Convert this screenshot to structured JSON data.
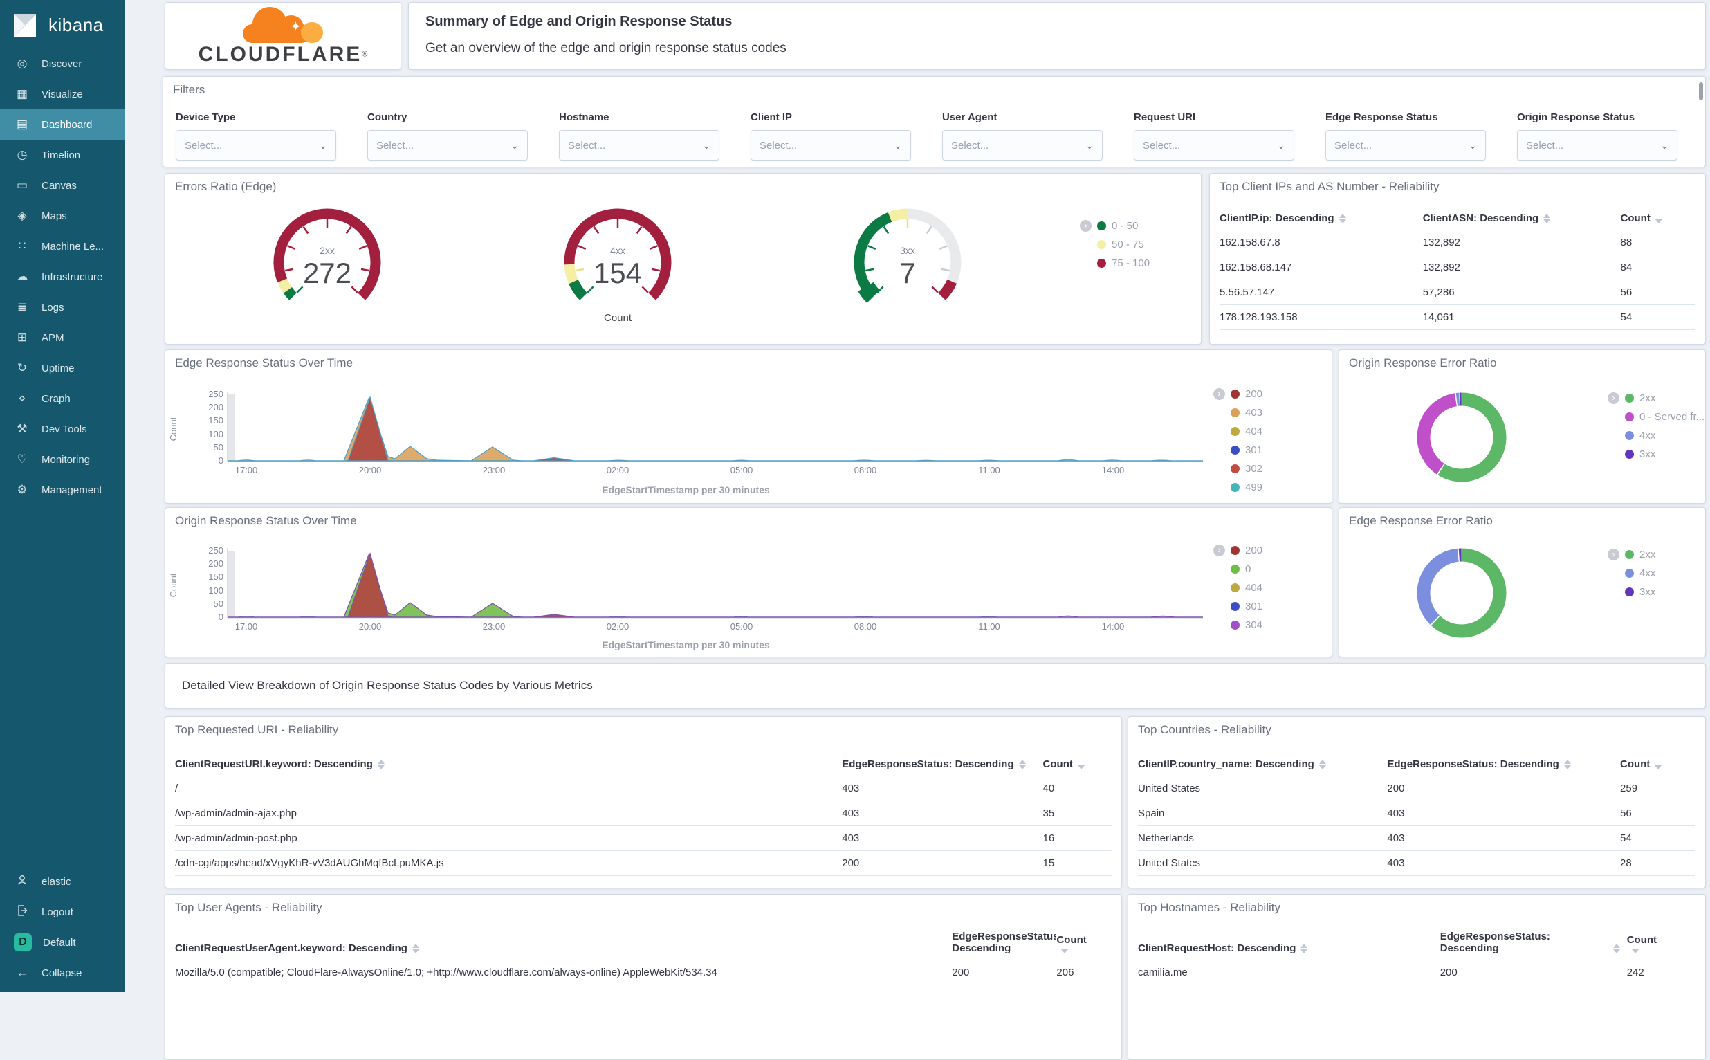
{
  "sidebar": {
    "logo_text": "kibana",
    "items": [
      {
        "label": "Discover",
        "icon": "compass"
      },
      {
        "label": "Visualize",
        "icon": "bar-chart"
      },
      {
        "label": "Dashboard",
        "icon": "dashboard-grid"
      },
      {
        "label": "Timelion",
        "icon": "time-chart"
      },
      {
        "label": "Canvas",
        "icon": "canvas"
      },
      {
        "label": "Maps",
        "icon": "map-marker"
      },
      {
        "label": "Machine Le...",
        "icon": "machine-learning"
      },
      {
        "label": "Infrastructure",
        "icon": "cloud"
      },
      {
        "label": "Logs",
        "icon": "logs"
      },
      {
        "label": "APM",
        "icon": "apm"
      },
      {
        "label": "Uptime",
        "icon": "uptime-clock"
      },
      {
        "label": "Graph",
        "icon": "graph-nodes"
      },
      {
        "label": "Dev Tools",
        "icon": "wrench"
      },
      {
        "label": "Monitoring",
        "icon": "heartbeat"
      },
      {
        "label": "Management",
        "icon": "gear"
      }
    ],
    "footer": [
      {
        "label": "elastic",
        "icon": "user"
      },
      {
        "label": "Logout",
        "icon": "exit"
      },
      {
        "label": "Default",
        "icon": "space-badge",
        "badge": "D"
      },
      {
        "label": "Collapse",
        "icon": "arrow-left"
      }
    ]
  },
  "header": {
    "brand": "CLOUDFLARE",
    "title": "Summary of Edge and Origin Response Status",
    "subtitle": "Get an overview of the edge and origin response status codes"
  },
  "filters": {
    "title": "Filters",
    "placeholder": "Select...",
    "fields": [
      "Device Type",
      "Country",
      "Hostname",
      "Client IP",
      "User Agent",
      "Request URI",
      "Edge Response Status",
      "Origin Response Status"
    ]
  },
  "markdown": {
    "text": "Detailed View Breakdown of Origin Response Status Codes by Various Metrics"
  },
  "chart_data": [
    {
      "id": "errors-ratio-edge",
      "type": "gauge",
      "title": "Errors Ratio (Edge)",
      "metric_label": "Count",
      "gauges": [
        {
          "label": "2xx",
          "value": 272
        },
        {
          "label": "4xx",
          "value": 154
        },
        {
          "label": "3xx",
          "value": 7
        }
      ],
      "ranges": [
        {
          "label": "0 - 50",
          "color": "#0B7A44"
        },
        {
          "label": "50 - 75",
          "color": "#F5EFA6"
        },
        {
          "label": "75 - 100",
          "color": "#A31F3E"
        }
      ]
    },
    {
      "id": "edge-response-status-over-time",
      "type": "area",
      "title": "Edge Response Status Over Time",
      "xlabel": "EdgeStartTimestamp per 30 minutes",
      "ylabel": "Count",
      "ylim": [
        0,
        250
      ],
      "y_ticks": [
        "0",
        "50",
        "100",
        "150",
        "200",
        "250"
      ],
      "x_ticks": [
        "17:00",
        "20:00",
        "23:00",
        "02:00",
        "05:00",
        "08:00",
        "11:00",
        "14:00"
      ],
      "legend_position": "right",
      "grid": false,
      "series": [
        {
          "name": "200",
          "color": "#A03533",
          "points": {
            "20:00": 240,
            "00:30": 12
          }
        },
        {
          "name": "403",
          "color": "#D9A15B",
          "points": {
            "20:00": 235,
            "21:00": 55,
            "23:00": 52
          }
        },
        {
          "name": "404",
          "color": "#BCA940",
          "points": {}
        },
        {
          "name": "301",
          "color": "#3C4EC6",
          "points": {}
        },
        {
          "name": "302",
          "color": "#C14C41",
          "points": {
            "21:30": 4
          }
        },
        {
          "name": "499",
          "color": "#45B5B8",
          "points": {
            "13:00": 3
          }
        }
      ]
    },
    {
      "id": "origin-response-error-ratio",
      "type": "pie",
      "title": "Origin Response Error Ratio",
      "slices": [
        {
          "label": "2xx",
          "value": 59.5,
          "color": "#5CB767"
        },
        {
          "label": "0 - Served fr...",
          "value": 38.5,
          "color": "#C050C9"
        },
        {
          "label": "4xx",
          "value": 1.2,
          "color": "#7B8FDE"
        },
        {
          "label": "3xx",
          "value": 0.8,
          "color": "#6135BE"
        }
      ]
    },
    {
      "id": "origin-response-status-over-time",
      "type": "area",
      "title": "Origin Response Status Over Time",
      "xlabel": "EdgeStartTimestamp per 30 minutes",
      "ylabel": "Count",
      "ylim": [
        0,
        250
      ],
      "y_ticks": [
        "0",
        "50",
        "100",
        "150",
        "200",
        "250"
      ],
      "x_ticks": [
        "17:00",
        "20:00",
        "23:00",
        "02:00",
        "05:00",
        "08:00",
        "11:00",
        "14:00"
      ],
      "legend_position": "right",
      "grid": false,
      "series": [
        {
          "name": "200",
          "color": "#A03533",
          "points": {
            "20:00": 240,
            "00:30": 10
          }
        },
        {
          "name": "0",
          "color": "#6CBF42",
          "points": {
            "20:00": 235,
            "21:00": 55,
            "23:00": 52
          }
        },
        {
          "name": "404",
          "color": "#BCA940",
          "points": {}
        },
        {
          "name": "301",
          "color": "#3C4EC6",
          "points": {}
        },
        {
          "name": "304",
          "color": "#A14FC9",
          "points": {
            "13:00": 3,
            "15:00": 3
          }
        }
      ]
    },
    {
      "id": "edge-response-error-ratio",
      "type": "pie",
      "title": "Edge Response Error Ratio",
      "slices": [
        {
          "label": "2xx",
          "value": 62.5,
          "color": "#5CB767"
        },
        {
          "label": "4xx",
          "value": 36.5,
          "color": "#7B8FDE"
        },
        {
          "label": "3xx",
          "value": 1,
          "color": "#6135BE"
        }
      ]
    }
  ],
  "tables": {
    "client_ips": {
      "title": "Top Client IPs and AS Number - Reliability",
      "columns": [
        "ClientIP.ip: Descending",
        "ClientASN: Descending",
        "Count"
      ],
      "rows": [
        [
          "162.158.67.8",
          "132,892",
          "88"
        ],
        [
          "162.158.68.147",
          "132,892",
          "84"
        ],
        [
          "5.56.57.147",
          "57,286",
          "56"
        ],
        [
          "178.128.193.158",
          "14,061",
          "54"
        ]
      ]
    },
    "requested_uri": {
      "title": "Top Requested URI - Reliability",
      "columns": [
        "ClientRequestURI.keyword: Descending",
        "EdgeResponseStatus: Descending",
        "Count"
      ],
      "rows": [
        [
          "/",
          "403",
          "40"
        ],
        [
          "/wp-admin/admin-ajax.php",
          "403",
          "35"
        ],
        [
          "/wp-admin/admin-post.php",
          "403",
          "16"
        ],
        [
          "/cdn-cgi/apps/head/xVgyKhR-vV3dAUGhMqfBcLpuMKA.js",
          "200",
          "15"
        ]
      ]
    },
    "countries": {
      "title": "Top Countries - Reliability",
      "columns": [
        "ClientIP.country_name: Descending",
        "EdgeResponseStatus: Descending",
        "Count"
      ],
      "rows": [
        [
          "United States",
          "200",
          "259"
        ],
        [
          "Spain",
          "403",
          "56"
        ],
        [
          "Netherlands",
          "403",
          "54"
        ],
        [
          "United States",
          "403",
          "28"
        ]
      ]
    },
    "user_agents": {
      "title": "Top User Agents - Reliability",
      "columns": [
        "ClientRequestUserAgent.keyword: Descending",
        "EdgeResponseStatus: Descending",
        "Count"
      ],
      "rows": [
        [
          "Mozilla/5.0 (compatible; CloudFlare-AlwaysOnline/1.0; +http://www.cloudflare.com/always-online) AppleWebKit/534.34",
          "200",
          "206"
        ]
      ]
    },
    "hostnames": {
      "title": "Top Hostnames - Reliability",
      "columns": [
        "ClientRequestHost: Descending",
        "EdgeResponseStatus: Descending",
        "Count"
      ],
      "rows": [
        [
          "camilia.me",
          "200",
          "242"
        ]
      ]
    }
  }
}
